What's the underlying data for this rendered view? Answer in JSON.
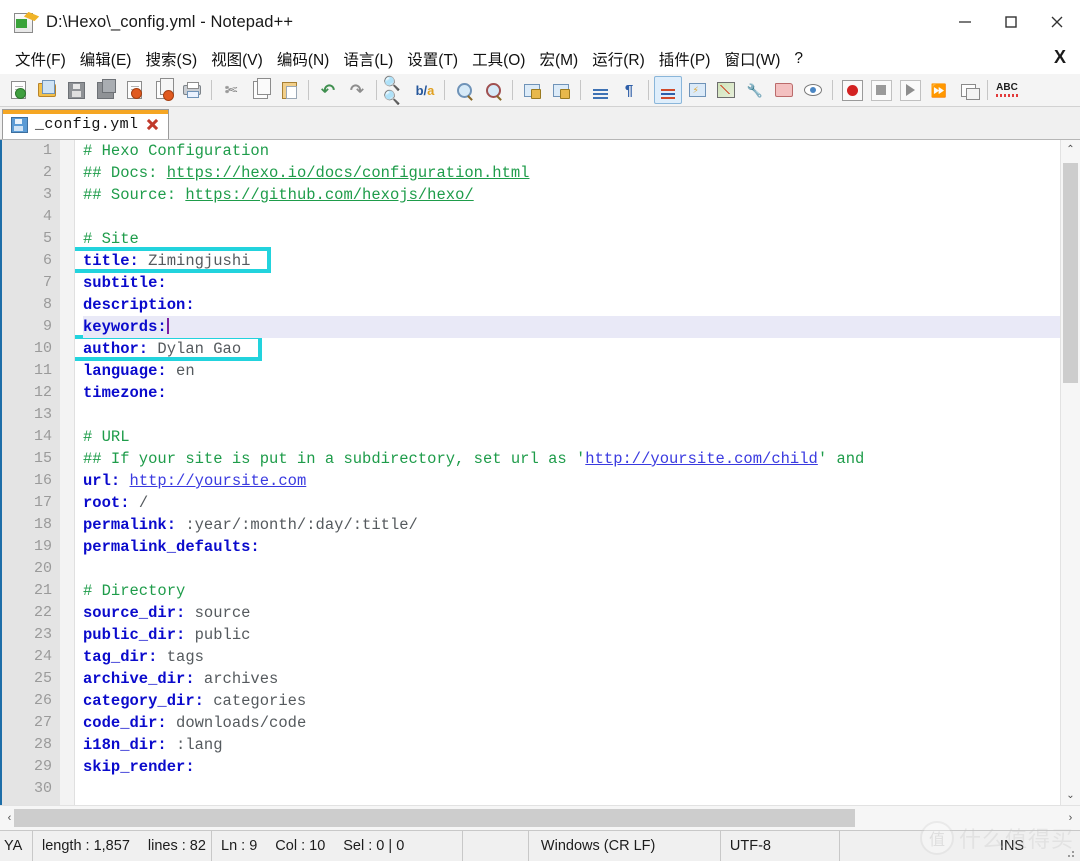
{
  "window": {
    "title": "D:\\Hexo\\_config.yml - Notepad++",
    "app_icon": "notepadpp-icon",
    "minimize_label": "—",
    "maximize_label": "☐",
    "close_label": "✕"
  },
  "menu": {
    "items": [
      {
        "name": "menu-file",
        "label": "文件(F)"
      },
      {
        "name": "menu-edit",
        "label": "编辑(E)"
      },
      {
        "name": "menu-search",
        "label": "搜索(S)"
      },
      {
        "name": "menu-view",
        "label": "视图(V)"
      },
      {
        "name": "menu-encoding",
        "label": "编码(N)"
      },
      {
        "name": "menu-language",
        "label": "语言(L)"
      },
      {
        "name": "menu-settings",
        "label": "设置(T)"
      },
      {
        "name": "menu-tools",
        "label": "工具(O)"
      },
      {
        "name": "menu-macro",
        "label": "宏(M)"
      },
      {
        "name": "menu-run",
        "label": "运行(R)"
      },
      {
        "name": "menu-plugins",
        "label": "插件(P)"
      },
      {
        "name": "menu-window",
        "label": "窗口(W)"
      },
      {
        "name": "menu-help",
        "label": "?"
      }
    ],
    "close_document": "X"
  },
  "toolbar": {
    "buttons": [
      {
        "name": "new-file-icon",
        "tip": "新建"
      },
      {
        "name": "open-file-icon",
        "tip": "打开"
      },
      {
        "name": "save-icon",
        "tip": "保存"
      },
      {
        "name": "save-all-icon",
        "tip": "全部保存"
      },
      {
        "name": "close-file-icon",
        "tip": "关闭"
      },
      {
        "name": "close-all-icon",
        "tip": "全部关闭"
      },
      {
        "name": "print-icon",
        "tip": "打印"
      },
      {
        "name": "cut-icon",
        "tip": "剪切"
      },
      {
        "name": "copy-icon",
        "tip": "复制"
      },
      {
        "name": "paste-icon",
        "tip": "粘贴"
      },
      {
        "name": "undo-icon",
        "tip": "撤销"
      },
      {
        "name": "redo-icon",
        "tip": "重做"
      },
      {
        "name": "find-icon",
        "tip": "查找"
      },
      {
        "name": "replace-icon",
        "tip": "替换"
      },
      {
        "name": "zoom-in-icon",
        "tip": "放大"
      },
      {
        "name": "zoom-out-icon",
        "tip": "缩小"
      },
      {
        "name": "sync-vertical-scroll-icon",
        "tip": "同步垂直滚动"
      },
      {
        "name": "sync-horizontal-scroll-icon",
        "tip": "同步水平滚动"
      },
      {
        "name": "word-wrap-icon",
        "tip": "自动换行"
      },
      {
        "name": "show-all-characters-icon",
        "tip": "显示所有字符"
      },
      {
        "name": "indent-guide-icon",
        "tip": "显示缩进参考线"
      },
      {
        "name": "user-defined-language-icon",
        "tip": "用户自定义语言"
      },
      {
        "name": "document-map-icon",
        "tip": "文档地图"
      },
      {
        "name": "function-list-icon",
        "tip": "函数列表"
      },
      {
        "name": "folder-as-workspace-icon",
        "tip": "文件夹作为工作区"
      },
      {
        "name": "preview-icon",
        "tip": "预览"
      },
      {
        "name": "macro-record-icon",
        "tip": "录制宏"
      },
      {
        "name": "macro-stop-icon",
        "tip": "停止录制"
      },
      {
        "name": "macro-play-icon",
        "tip": "回放"
      },
      {
        "name": "macro-run-multiple-icon",
        "tip": "多次运行"
      },
      {
        "name": "save-macro-icon",
        "tip": "保存当前录制的宏"
      },
      {
        "name": "spellcheck-icon",
        "tip": "拼写检查"
      }
    ]
  },
  "tabs": [
    {
      "name": "tab-config-yml",
      "label": "_config.yml",
      "active": true,
      "saved_icon": "floppy-icon",
      "close_icon": "close-tab-icon"
    }
  ],
  "editor": {
    "first_line": 1,
    "current_line": 9,
    "lines": [
      {
        "n": 1,
        "tokens": [
          {
            "t": "cmt",
            "v": "# Hexo Configuration"
          }
        ]
      },
      {
        "n": 2,
        "tokens": [
          {
            "t": "cmt",
            "v": "## Docs: "
          },
          {
            "t": "url",
            "v": "https://hexo.io/docs/configuration.html"
          }
        ]
      },
      {
        "n": 3,
        "tokens": [
          {
            "t": "cmt",
            "v": "## Source: "
          },
          {
            "t": "url",
            "v": "https://github.com/hexojs/hexo/"
          }
        ]
      },
      {
        "n": 4,
        "tokens": []
      },
      {
        "n": 5,
        "tokens": [
          {
            "t": "cmt",
            "v": "# Site"
          }
        ]
      },
      {
        "n": 6,
        "tokens": [
          {
            "t": "key",
            "v": "title:"
          },
          {
            "t": "val",
            "v": " Zimingjushi"
          }
        ]
      },
      {
        "n": 7,
        "tokens": [
          {
            "t": "key",
            "v": "subtitle:"
          }
        ]
      },
      {
        "n": 8,
        "tokens": [
          {
            "t": "key",
            "v": "description:"
          }
        ]
      },
      {
        "n": 9,
        "tokens": [
          {
            "t": "key",
            "v": "keywords:"
          },
          {
            "t": "caret",
            "v": ""
          }
        ]
      },
      {
        "n": 10,
        "tokens": [
          {
            "t": "key",
            "v": "author:"
          },
          {
            "t": "val",
            "v": " Dylan Gao"
          }
        ]
      },
      {
        "n": 11,
        "tokens": [
          {
            "t": "key",
            "v": "language:"
          },
          {
            "t": "val",
            "v": " en"
          }
        ]
      },
      {
        "n": 12,
        "tokens": [
          {
            "t": "key",
            "v": "timezone:"
          }
        ]
      },
      {
        "n": 13,
        "tokens": []
      },
      {
        "n": 14,
        "tokens": [
          {
            "t": "cmt",
            "v": "# URL"
          }
        ]
      },
      {
        "n": 15,
        "tokens": [
          {
            "t": "cmt",
            "v": "## If your site is put in a subdirectory, set url as '"
          },
          {
            "t": "url-b",
            "v": "http://yoursite.com/child"
          },
          {
            "t": "cmt",
            "v": "' and"
          }
        ]
      },
      {
        "n": 16,
        "tokens": [
          {
            "t": "key",
            "v": "url:"
          },
          {
            "t": "val",
            "v": " "
          },
          {
            "t": "url-b",
            "v": "http://yoursite.com"
          }
        ]
      },
      {
        "n": 17,
        "tokens": [
          {
            "t": "key",
            "v": "root:"
          },
          {
            "t": "val",
            "v": " /"
          }
        ]
      },
      {
        "n": 18,
        "tokens": [
          {
            "t": "key",
            "v": "permalink:"
          },
          {
            "t": "val",
            "v": " :year/:month/:day/:title/"
          }
        ]
      },
      {
        "n": 19,
        "tokens": [
          {
            "t": "key",
            "v": "permalink_defaults:"
          }
        ]
      },
      {
        "n": 20,
        "tokens": []
      },
      {
        "n": 21,
        "tokens": [
          {
            "t": "cmt",
            "v": "# Directory"
          }
        ]
      },
      {
        "n": 22,
        "tokens": [
          {
            "t": "key",
            "v": "source_dir:"
          },
          {
            "t": "val",
            "v": " source"
          }
        ]
      },
      {
        "n": 23,
        "tokens": [
          {
            "t": "key",
            "v": "public_dir:"
          },
          {
            "t": "val",
            "v": " public"
          }
        ]
      },
      {
        "n": 24,
        "tokens": [
          {
            "t": "key",
            "v": "tag_dir:"
          },
          {
            "t": "val",
            "v": " tags"
          }
        ]
      },
      {
        "n": 25,
        "tokens": [
          {
            "t": "key",
            "v": "archive_dir:"
          },
          {
            "t": "val",
            "v": " archives"
          }
        ]
      },
      {
        "n": 26,
        "tokens": [
          {
            "t": "key",
            "v": "category_dir:"
          },
          {
            "t": "val",
            "v": " categories"
          }
        ]
      },
      {
        "n": 27,
        "tokens": [
          {
            "t": "key",
            "v": "code_dir:"
          },
          {
            "t": "val",
            "v": " downloads/code"
          }
        ]
      },
      {
        "n": 28,
        "tokens": [
          {
            "t": "key",
            "v": "i18n_dir:"
          },
          {
            "t": "val",
            "v": " :lang"
          }
        ]
      },
      {
        "n": 29,
        "tokens": [
          {
            "t": "key",
            "v": "skip_render:"
          }
        ]
      },
      {
        "n": 30,
        "tokens": []
      }
    ],
    "annotations": [
      {
        "name": "highlight-box-title",
        "line": 6,
        "label": "title: Zimingjushi",
        "color": "#22d3dd"
      },
      {
        "name": "highlight-box-author",
        "line": 10,
        "label": "author: Dylan Gao",
        "color": "#22d3dd"
      }
    ]
  },
  "scrollbars": {
    "vertical": {
      "up_arrow": "⌃",
      "down_arrow": "⌄"
    },
    "horizontal": {
      "left_arrow": "‹",
      "right_arrow": "›"
    }
  },
  "statusbar": {
    "language": "YA",
    "length_label": "length : 1,857",
    "lines_label": "lines : 82",
    "ln": "Ln : 9",
    "col": "Col : 10",
    "sel": "Sel : 0 | 0",
    "eol": "Windows (CR LF)",
    "encoding": "UTF-8",
    "insert_mode": "INS"
  },
  "watermark": {
    "badge": "值",
    "text": "什么值得买"
  },
  "colors": {
    "accent_tab": "#f5a623",
    "comment": "#1e9c4a",
    "key": "#0a0acc",
    "value": "#555a5e",
    "link": "#3a3ae0",
    "annotation": "#22d3dd",
    "current_line": "#e9e9f7"
  }
}
